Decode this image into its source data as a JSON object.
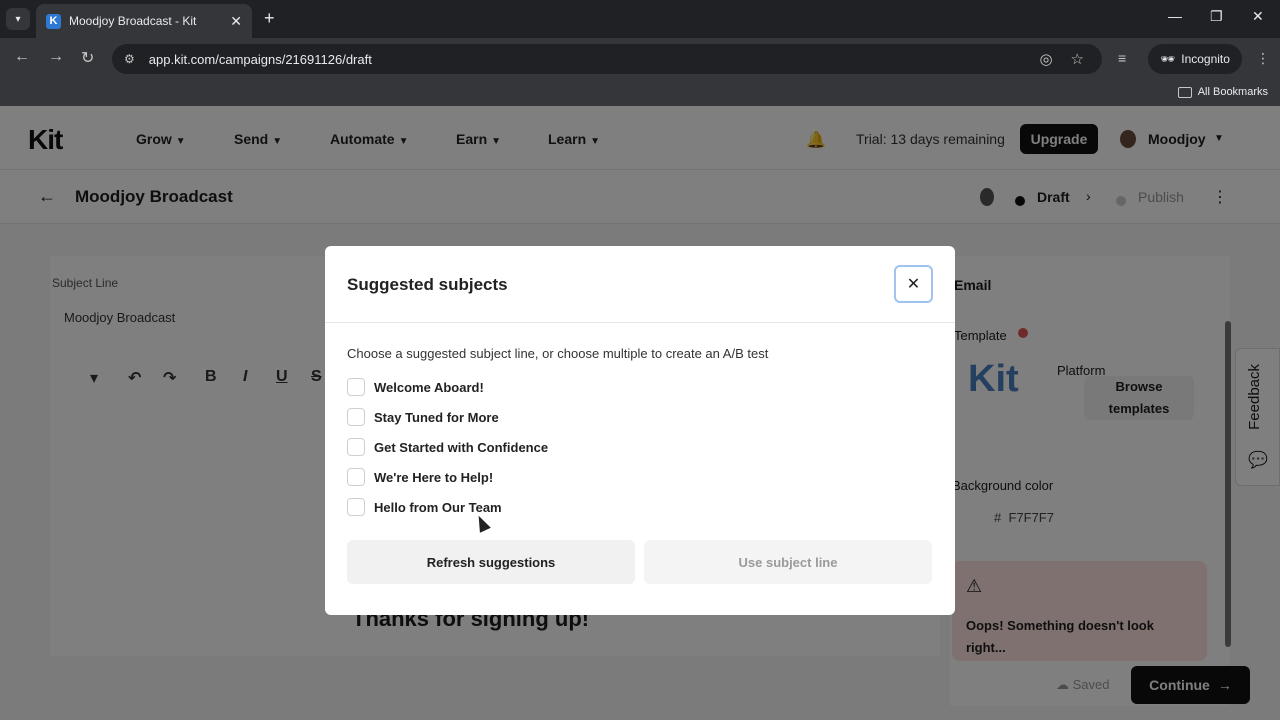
{
  "browser": {
    "tab_title": "Moodjoy Broadcast - Kit",
    "favicon_letter": "K",
    "url": "app.kit.com/campaigns/21691126/draft",
    "incognito_label": "Incognito",
    "bookmarks_label": "All Bookmarks"
  },
  "app": {
    "logo": "Kit",
    "nav": [
      {
        "label": "Grow"
      },
      {
        "label": "Send"
      },
      {
        "label": "Automate"
      },
      {
        "label": "Earn"
      },
      {
        "label": "Learn"
      }
    ],
    "trial_text": "Trial: 13 days remaining",
    "upgrade_label": "Upgrade",
    "user_name": "Moodjoy"
  },
  "subheader": {
    "title": "Moodjoy Broadcast",
    "status": "Draft",
    "publish_label": "Publish"
  },
  "editor": {
    "subject_label": "Subject Line",
    "subject_value": "Moodjoy Broadcast",
    "body_heading": "Thanks for signing up!"
  },
  "side_panel": {
    "title": "Email",
    "template_label": "Template",
    "template_logo": "Kit",
    "platform_label": "Platform",
    "browse_label": "Browse templates",
    "bg_label": "Background color",
    "bg_value": "F7F7F7",
    "warning_text": "Oops! Something doesn't look right..."
  },
  "footer": {
    "saved_label": "Saved",
    "continue_label": "Continue"
  },
  "feedback_label": "Feedback",
  "modal": {
    "title": "Suggested subjects",
    "description": "Choose a suggested subject line, or choose multiple to create an A/B test",
    "options": [
      {
        "label": "Welcome Aboard!",
        "checked": false
      },
      {
        "label": "Stay Tuned for More",
        "checked": false
      },
      {
        "label": "Get Started with Confidence",
        "checked": false
      },
      {
        "label": "We're Here to Help!",
        "checked": false
      },
      {
        "label": "Hello from Our Team",
        "checked": false
      }
    ],
    "refresh_label": "Refresh suggestions",
    "use_label": "Use subject line"
  },
  "colors": {
    "accent_dark": "#111111",
    "warning_bg": "#fde3e1",
    "focus_ring": "#9fc3ef"
  }
}
